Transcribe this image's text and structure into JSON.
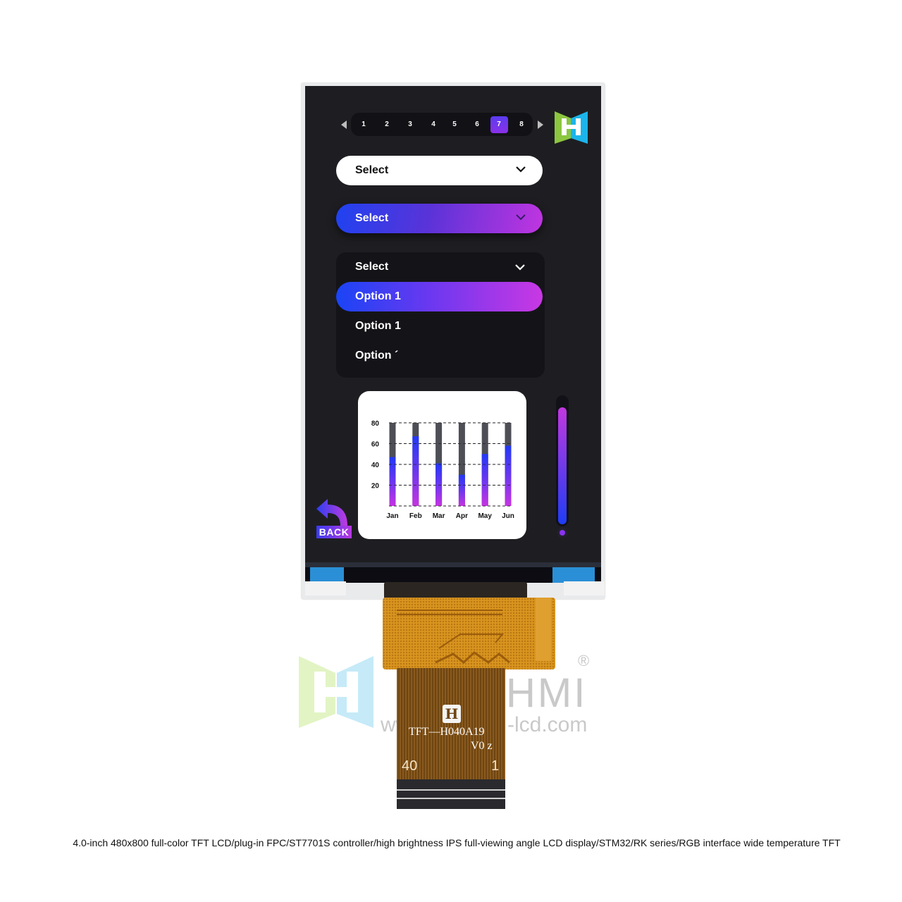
{
  "product": {
    "caption": "4.0-inch 480x800 full-color TFT LCD/plug-in FPC/ST7701S controller/high brightness IPS full-viewing angle LCD display/STM32/RK series/RGB interface wide temperature TFT",
    "fpc_model": "TFT—H040A19",
    "fpc_version": "V0 z",
    "fpc_logo": "H",
    "pin_left": "40",
    "pin_right": "1"
  },
  "watermark": {
    "brand_left": "H",
    "brand_right": "HMI",
    "registered": "®",
    "url_left": "www.",
    "url_right": "-lcd.com"
  },
  "screen": {
    "pagination": {
      "prev_icon": "triangle-left",
      "next_icon": "triangle-right",
      "pages": [
        "1",
        "2",
        "3",
        "4",
        "5",
        "6",
        "7",
        "8"
      ],
      "active_page": "7"
    },
    "brand_logo": "H-logo",
    "select_white": {
      "label": "Select",
      "icon": "chevron-down"
    },
    "select_gradient": {
      "label": "Select",
      "icon": "chevron-down"
    },
    "dropdown": {
      "label": "Select",
      "icon": "chevron-down",
      "options": [
        "Option 1",
        "Option 1",
        "Option ´"
      ],
      "selected_index": 0
    },
    "back_button": {
      "label": "BACK",
      "icon": "curved-back-arrow"
    },
    "slider": {
      "value_percent": 92
    },
    "colors": {
      "background": "#1e1e22",
      "accent_blue": "#1f42f0",
      "accent_purple": "#c035e0",
      "bar_remaining": "#4e4e56"
    }
  },
  "chart_data": {
    "type": "bar",
    "title": "",
    "xlabel": "",
    "ylabel": "",
    "categories": [
      "Jan",
      "Feb",
      "Mar",
      "Apr",
      "May",
      "Jun"
    ],
    "values": [
      47,
      67,
      41,
      30,
      50,
      58
    ],
    "max": 80,
    "ylim": [
      0,
      80
    ],
    "yticks": [
      "20",
      "40",
      "60",
      "80"
    ],
    "ytick_values": [
      20,
      40,
      60,
      80
    ],
    "grid": true,
    "grid_style": "dashed",
    "legend": "none"
  }
}
